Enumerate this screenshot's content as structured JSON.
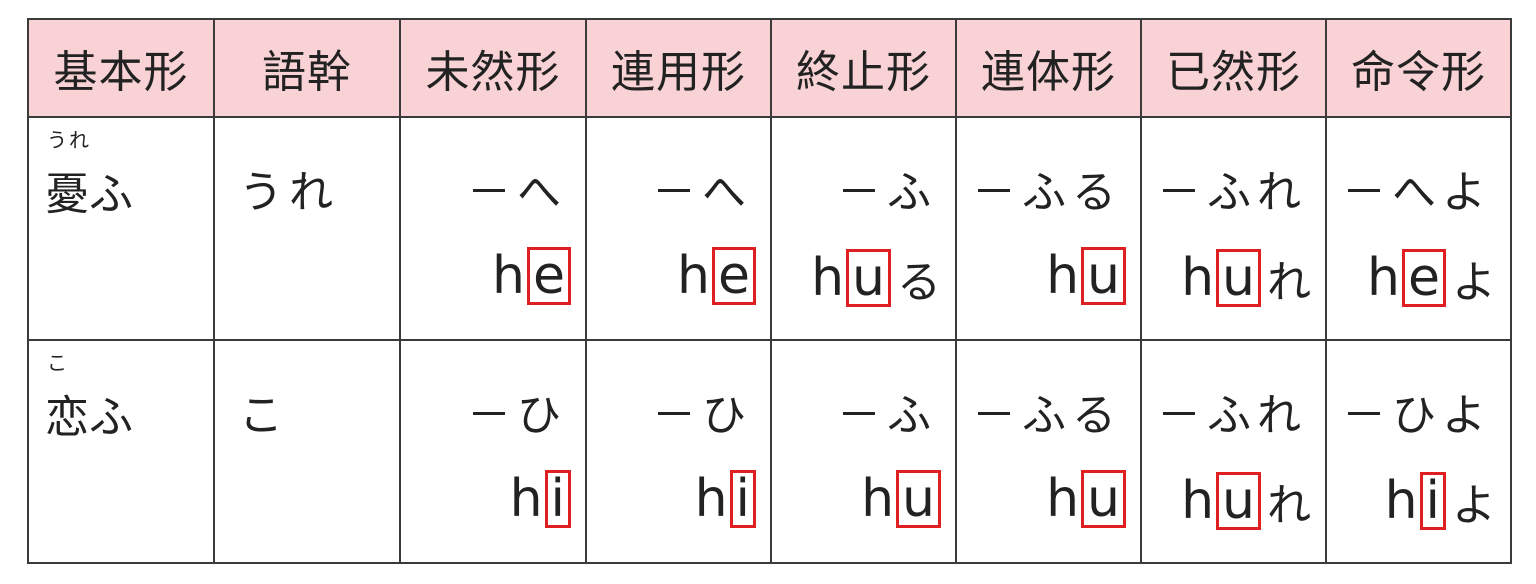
{
  "headers": [
    "基本形",
    "語幹",
    "未然形",
    "連用形",
    "終止形",
    "連体形",
    "已然形",
    "命令形"
  ],
  "rows": [
    {
      "word": "憂ふ",
      "ruby": "うれ",
      "stem": "うれ",
      "forms": [
        {
          "kana": "－へ",
          "lead": "h",
          "vowel": "e",
          "tail": ""
        },
        {
          "kana": "－へ",
          "lead": "h",
          "vowel": "e",
          "tail": ""
        },
        {
          "kana": "－ふ",
          "lead": "h",
          "vowel": "u",
          "tail": "る"
        },
        {
          "kana": "－ふる",
          "lead": "h",
          "vowel": "u",
          "tail": ""
        },
        {
          "kana": "－ふれ",
          "lead": "h",
          "vowel": "u",
          "tail": "れ"
        },
        {
          "kana": "－へよ",
          "lead": "h",
          "vowel": "e",
          "tail": "よ"
        }
      ]
    },
    {
      "word": "恋ふ",
      "ruby": "こ",
      "stem": "こ",
      "forms": [
        {
          "kana": "－ひ",
          "lead": "h",
          "vowel": "i",
          "tail": ""
        },
        {
          "kana": "－ひ",
          "lead": "h",
          "vowel": "i",
          "tail": ""
        },
        {
          "kana": "－ふ",
          "lead": "h",
          "vowel": "u",
          "tail": ""
        },
        {
          "kana": "－ふる",
          "lead": "h",
          "vowel": "u",
          "tail": ""
        },
        {
          "kana": "－ふれ",
          "lead": "h",
          "vowel": "u",
          "tail": "れ"
        },
        {
          "kana": "－ひよ",
          "lead": "h",
          "vowel": "i",
          "tail": "よ"
        }
      ]
    }
  ],
  "colors": {
    "header_bg": "#f8d2d4",
    "highlight_box": "#e02020",
    "border": "#3a3a3a"
  }
}
